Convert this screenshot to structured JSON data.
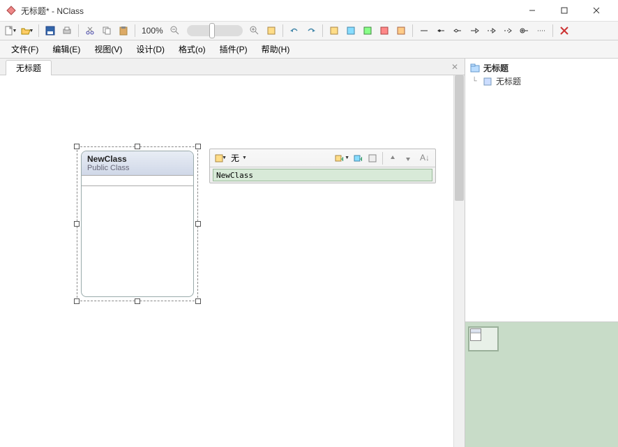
{
  "title": "无标题* - NClass",
  "menubar": {
    "file": "文件(F)",
    "edit": "编辑(E)",
    "view": "视图(V)",
    "design": "设计(D)",
    "format": "格式(o)",
    "plugin": "插件(P)",
    "help": "帮助(H)"
  },
  "toolbar": {
    "zoom_value": "100%"
  },
  "tab": {
    "label": "无标题"
  },
  "class": {
    "name": "NewClass",
    "type": "Public Class"
  },
  "float_toolbar": {
    "access_label": "无",
    "input_value": "NewClass"
  },
  "tree": {
    "root": "无标题",
    "child": "无标题"
  }
}
